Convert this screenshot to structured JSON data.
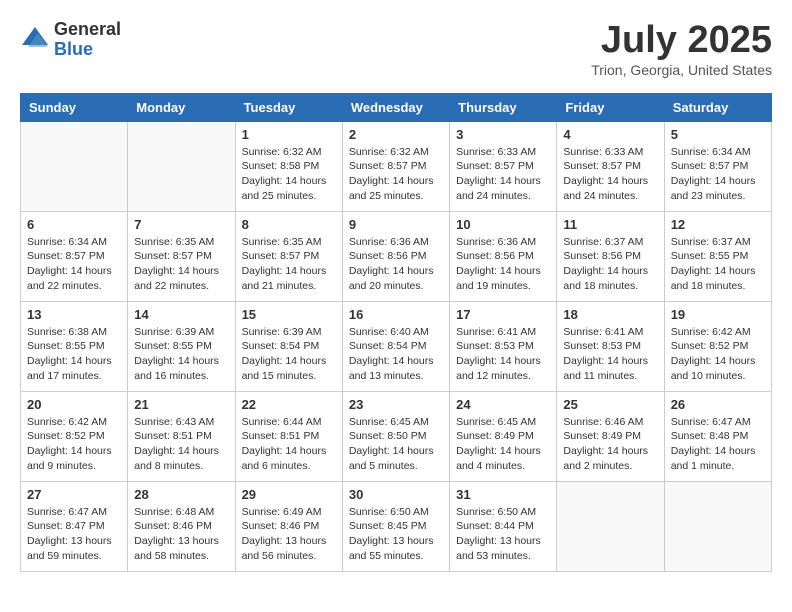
{
  "header": {
    "logo_general": "General",
    "logo_blue": "Blue",
    "month_title": "July 2025",
    "location": "Trion, Georgia, United States"
  },
  "days_of_week": [
    "Sunday",
    "Monday",
    "Tuesday",
    "Wednesday",
    "Thursday",
    "Friday",
    "Saturday"
  ],
  "weeks": [
    [
      {
        "day": "",
        "info": ""
      },
      {
        "day": "",
        "info": ""
      },
      {
        "day": "1",
        "info": "Sunrise: 6:32 AM\nSunset: 8:58 PM\nDaylight: 14 hours and 25 minutes."
      },
      {
        "day": "2",
        "info": "Sunrise: 6:32 AM\nSunset: 8:57 PM\nDaylight: 14 hours and 25 minutes."
      },
      {
        "day": "3",
        "info": "Sunrise: 6:33 AM\nSunset: 8:57 PM\nDaylight: 14 hours and 24 minutes."
      },
      {
        "day": "4",
        "info": "Sunrise: 6:33 AM\nSunset: 8:57 PM\nDaylight: 14 hours and 24 minutes."
      },
      {
        "day": "5",
        "info": "Sunrise: 6:34 AM\nSunset: 8:57 PM\nDaylight: 14 hours and 23 minutes."
      }
    ],
    [
      {
        "day": "6",
        "info": "Sunrise: 6:34 AM\nSunset: 8:57 PM\nDaylight: 14 hours and 22 minutes."
      },
      {
        "day": "7",
        "info": "Sunrise: 6:35 AM\nSunset: 8:57 PM\nDaylight: 14 hours and 22 minutes."
      },
      {
        "day": "8",
        "info": "Sunrise: 6:35 AM\nSunset: 8:57 PM\nDaylight: 14 hours and 21 minutes."
      },
      {
        "day": "9",
        "info": "Sunrise: 6:36 AM\nSunset: 8:56 PM\nDaylight: 14 hours and 20 minutes."
      },
      {
        "day": "10",
        "info": "Sunrise: 6:36 AM\nSunset: 8:56 PM\nDaylight: 14 hours and 19 minutes."
      },
      {
        "day": "11",
        "info": "Sunrise: 6:37 AM\nSunset: 8:56 PM\nDaylight: 14 hours and 18 minutes."
      },
      {
        "day": "12",
        "info": "Sunrise: 6:37 AM\nSunset: 8:55 PM\nDaylight: 14 hours and 18 minutes."
      }
    ],
    [
      {
        "day": "13",
        "info": "Sunrise: 6:38 AM\nSunset: 8:55 PM\nDaylight: 14 hours and 17 minutes."
      },
      {
        "day": "14",
        "info": "Sunrise: 6:39 AM\nSunset: 8:55 PM\nDaylight: 14 hours and 16 minutes."
      },
      {
        "day": "15",
        "info": "Sunrise: 6:39 AM\nSunset: 8:54 PM\nDaylight: 14 hours and 15 minutes."
      },
      {
        "day": "16",
        "info": "Sunrise: 6:40 AM\nSunset: 8:54 PM\nDaylight: 14 hours and 13 minutes."
      },
      {
        "day": "17",
        "info": "Sunrise: 6:41 AM\nSunset: 8:53 PM\nDaylight: 14 hours and 12 minutes."
      },
      {
        "day": "18",
        "info": "Sunrise: 6:41 AM\nSunset: 8:53 PM\nDaylight: 14 hours and 11 minutes."
      },
      {
        "day": "19",
        "info": "Sunrise: 6:42 AM\nSunset: 8:52 PM\nDaylight: 14 hours and 10 minutes."
      }
    ],
    [
      {
        "day": "20",
        "info": "Sunrise: 6:42 AM\nSunset: 8:52 PM\nDaylight: 14 hours and 9 minutes."
      },
      {
        "day": "21",
        "info": "Sunrise: 6:43 AM\nSunset: 8:51 PM\nDaylight: 14 hours and 8 minutes."
      },
      {
        "day": "22",
        "info": "Sunrise: 6:44 AM\nSunset: 8:51 PM\nDaylight: 14 hours and 6 minutes."
      },
      {
        "day": "23",
        "info": "Sunrise: 6:45 AM\nSunset: 8:50 PM\nDaylight: 14 hours and 5 minutes."
      },
      {
        "day": "24",
        "info": "Sunrise: 6:45 AM\nSunset: 8:49 PM\nDaylight: 14 hours and 4 minutes."
      },
      {
        "day": "25",
        "info": "Sunrise: 6:46 AM\nSunset: 8:49 PM\nDaylight: 14 hours and 2 minutes."
      },
      {
        "day": "26",
        "info": "Sunrise: 6:47 AM\nSunset: 8:48 PM\nDaylight: 14 hours and 1 minute."
      }
    ],
    [
      {
        "day": "27",
        "info": "Sunrise: 6:47 AM\nSunset: 8:47 PM\nDaylight: 13 hours and 59 minutes."
      },
      {
        "day": "28",
        "info": "Sunrise: 6:48 AM\nSunset: 8:46 PM\nDaylight: 13 hours and 58 minutes."
      },
      {
        "day": "29",
        "info": "Sunrise: 6:49 AM\nSunset: 8:46 PM\nDaylight: 13 hours and 56 minutes."
      },
      {
        "day": "30",
        "info": "Sunrise: 6:50 AM\nSunset: 8:45 PM\nDaylight: 13 hours and 55 minutes."
      },
      {
        "day": "31",
        "info": "Sunrise: 6:50 AM\nSunset: 8:44 PM\nDaylight: 13 hours and 53 minutes."
      },
      {
        "day": "",
        "info": ""
      },
      {
        "day": "",
        "info": ""
      }
    ]
  ]
}
